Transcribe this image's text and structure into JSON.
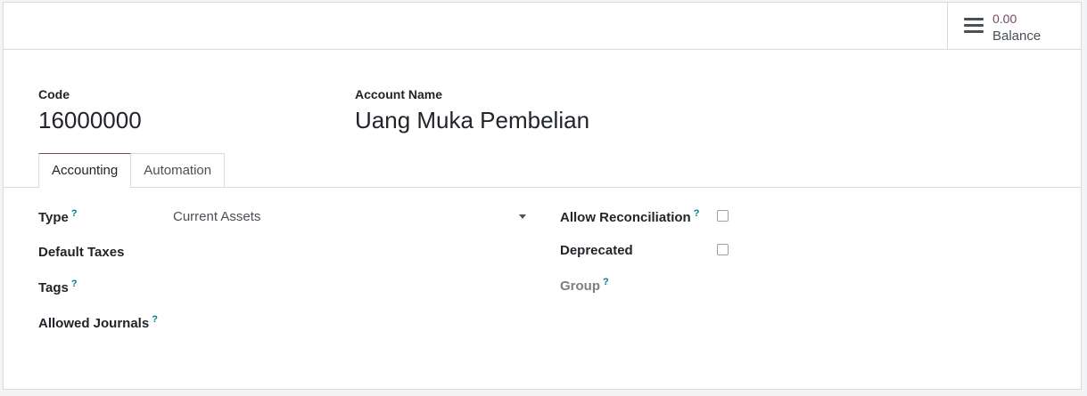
{
  "stat_button": {
    "value": "0.00",
    "label": "Balance",
    "icon": "bars-icon"
  },
  "header": {
    "code_label": "Code",
    "code_value": "16000000",
    "name_label": "Account Name",
    "name_value": "Uang Muka Pembelian"
  },
  "tabs": [
    {
      "label": "Accounting",
      "active": true
    },
    {
      "label": "Automation",
      "active": false
    }
  ],
  "left_fields": {
    "type_label": "Type",
    "type_value": "Current Assets",
    "default_taxes_label": "Default Taxes",
    "tags_label": "Tags",
    "allowed_journals_label": "Allowed Journals"
  },
  "right_fields": {
    "allow_reconciliation_label": "Allow Reconciliation",
    "allow_reconciliation_checked": false,
    "deprecated_label": "Deprecated",
    "deprecated_checked": false,
    "group_label": "Group"
  },
  "help_marker": "?",
  "colors": {
    "accent": "#714b67",
    "help": "#017e84"
  }
}
